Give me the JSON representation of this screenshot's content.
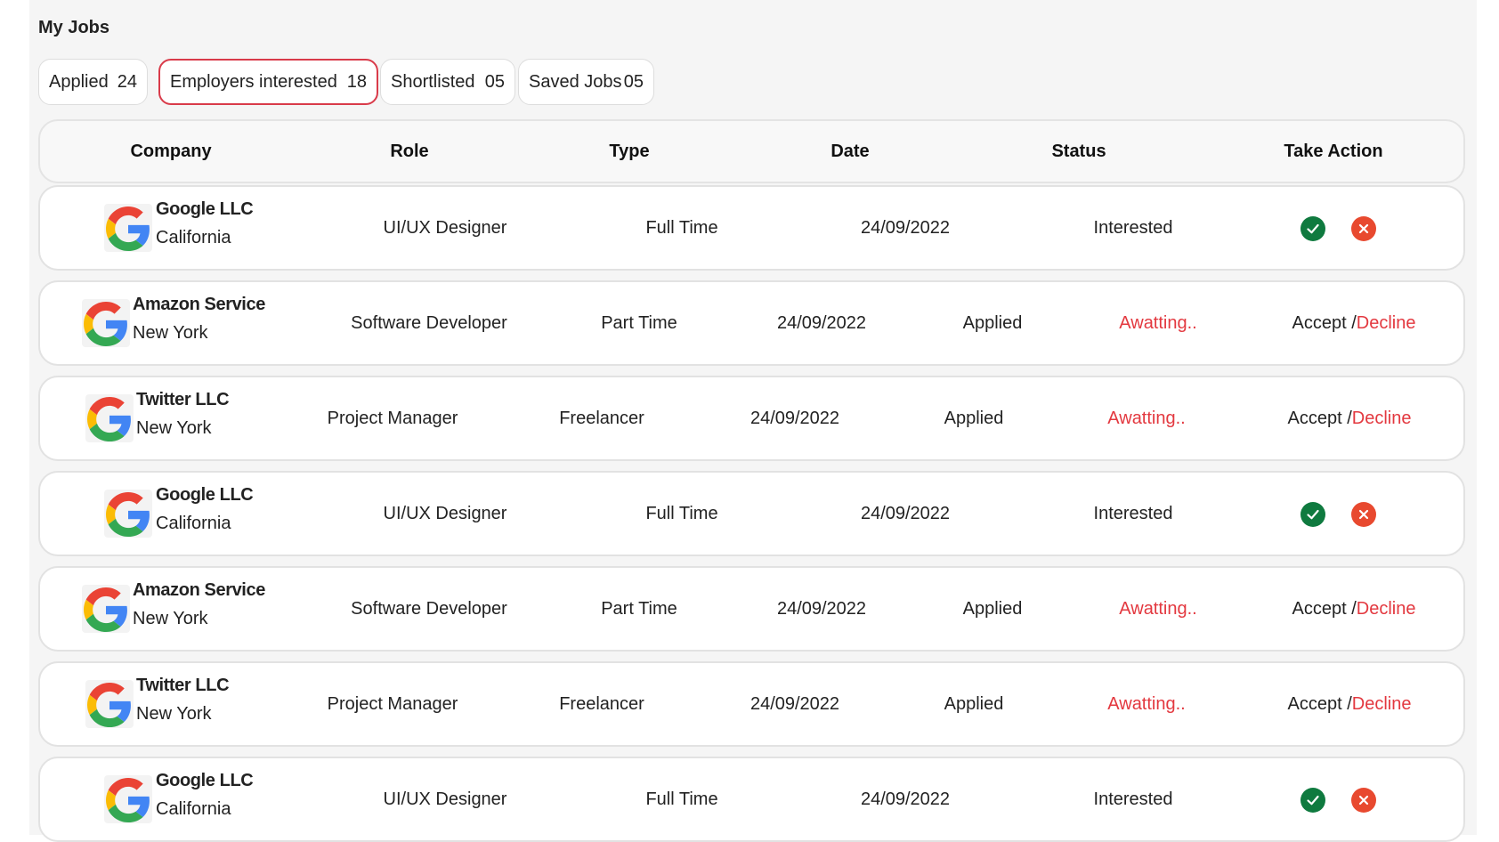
{
  "page": {
    "title": "My Jobs"
  },
  "tabs": [
    {
      "label": "Applied",
      "count": "24",
      "active": false
    },
    {
      "label": "Employers interested",
      "count": "18",
      "active": true
    },
    {
      "label": "Shortlisted",
      "count": "05",
      "active": false
    },
    {
      "label": "Saved Jobs",
      "count": "05",
      "active": false
    }
  ],
  "table": {
    "headers": [
      "Company",
      "Role",
      "Type",
      "Date",
      "Status",
      "Take Action"
    ],
    "rows": [
      {
        "company": "Google LLC",
        "location": "California",
        "role": "UI/UX Designer",
        "type": "Full Time",
        "date": "24/09/2022",
        "status": "Interested",
        "variant": "interested",
        "logo": "google-logo-icon"
      },
      {
        "company": "Amazon Service",
        "location": "New York",
        "role": "Software Developer",
        "type": "Part Time",
        "date": "24/09/2022",
        "status": "Applied",
        "awaiting": "Awatting..",
        "accept": "Accept /",
        "decline": "Decline",
        "variant": "applied",
        "logo": "google-logo-icon"
      },
      {
        "company": "Twitter LLC",
        "location": "New York",
        "role": "Project Manager",
        "type": "Freelancer",
        "date": "24/09/2022",
        "status": "Applied",
        "awaiting": "Awatting..",
        "accept": "Accept /",
        "decline": "Decline",
        "variant": "applied",
        "logo": "google-logo-icon"
      },
      {
        "company": "Google LLC",
        "location": "California",
        "role": "UI/UX Designer",
        "type": "Full Time",
        "date": "24/09/2022",
        "status": "Interested",
        "variant": "interested",
        "logo": "google-logo-icon"
      },
      {
        "company": "Amazon Service",
        "location": "New York",
        "role": "Software Developer",
        "type": "Part Time",
        "date": "24/09/2022",
        "status": "Applied",
        "awaiting": "Awatting..",
        "accept": "Accept /",
        "decline": "Decline",
        "variant": "applied",
        "logo": "google-logo-icon"
      },
      {
        "company": "Twitter LLC",
        "location": "New York",
        "role": "Project Manager",
        "type": "Freelancer",
        "date": "24/09/2022",
        "status": "Applied",
        "awaiting": "Awatting..",
        "accept": "Accept /",
        "decline": "Decline",
        "variant": "applied",
        "logo": "google-logo-icon"
      },
      {
        "company": "Google LLC",
        "location": "California",
        "role": "UI/UX Designer",
        "type": "Full Time",
        "date": "24/09/2022",
        "status": "Interested",
        "variant": "interested",
        "logo": "google-logo-icon"
      }
    ]
  },
  "colors": {
    "active_tab_border": "#d93b4a",
    "awaiting_text": "#e3383f",
    "accept_icon": "#0f7a3f",
    "decline_icon": "#e8492f"
  },
  "icons": {
    "accept": "check-circle-icon",
    "decline": "x-circle-icon"
  }
}
